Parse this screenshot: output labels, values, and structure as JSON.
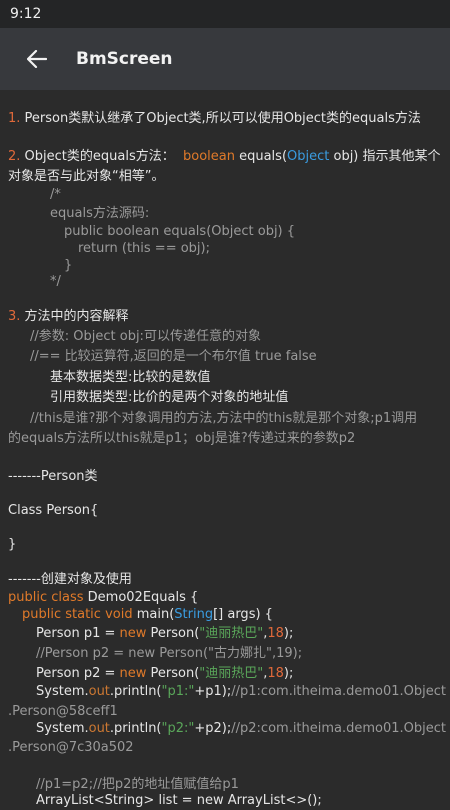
{
  "status": {
    "time": "9:12"
  },
  "appbar": {
    "title": "BmScreen"
  },
  "p1": {
    "num": "1.",
    "text": " Person类默认继承了Object类,所以可以使用Object类的equals方法"
  },
  "p2": {
    "num": "2.",
    "t1": " Object类的equals方法：",
    "kw": "boolean",
    "t2": " equals(",
    "obj": "Object",
    "t3": " obj) 指示其他某个",
    "line2": "对象是否与此对象“相等”。"
  },
  "src": {
    "l1": "/*",
    "l2": "equals方法源码:",
    "l3": "public boolean equals(Object obj) {",
    "l4": "return (this == obj);",
    "l5": "}",
    "l6": "*/"
  },
  "p3": {
    "num": "3.",
    "title": " 方法中的内容解释",
    "c1": "//参数: Object obj:可以传递任意的对象",
    "c2": "//== 比较运算符,返回的是一个布尔值 true false",
    "b1": "基本数据类型:比较的是数值",
    "b2": "引用数据类型:比价的是两个对象的地址值",
    "c3": "//this是谁?那个对象调用的方法,方法中的this就是那个对象;p1调用",
    "c4": "的equals方法所以this就是p1；obj是谁?传递过来的参数p2"
  },
  "person": {
    "h": "-------Person类",
    "cls": "Class Person{",
    "close": "}"
  },
  "demo": {
    "h": "-------创建对象及使用",
    "pc": "public class",
    "cname": " Demo02Equals {",
    "psv": "public static void",
    "main": " main(",
    "String": "String",
    "args": "[] args) {",
    "p1a": "Person p1 = ",
    "new": "new",
    "person": " Person(",
    "s1": "\"迪丽热巴\"",
    "comma": ",",
    "n18": "18",
    "end": ");",
    "cm1": "//Person p2 = new Person(\"古力娜扎\",19);",
    "p2a": "Person p2 = ",
    "sys": "System.",
    "out": "out",
    "println": ".println(",
    "sp1": "\"p1:\"",
    "plus1": "+p1);",
    "cm2": "//p1:com.itheima.demo01.Object",
    "cm2b": ".Person@58ceff1",
    "sp2": "\"p2:\"",
    "plus2": "+p2);",
    "cm3": "//p2:com.itheima.demo01.Object",
    "cm3b": ".Person@7c30a502",
    "cm4": "//p1=p2;//把p2的地址值赋值给p1",
    "last": "ArrayList<String> list = new ArrayList<>();"
  }
}
